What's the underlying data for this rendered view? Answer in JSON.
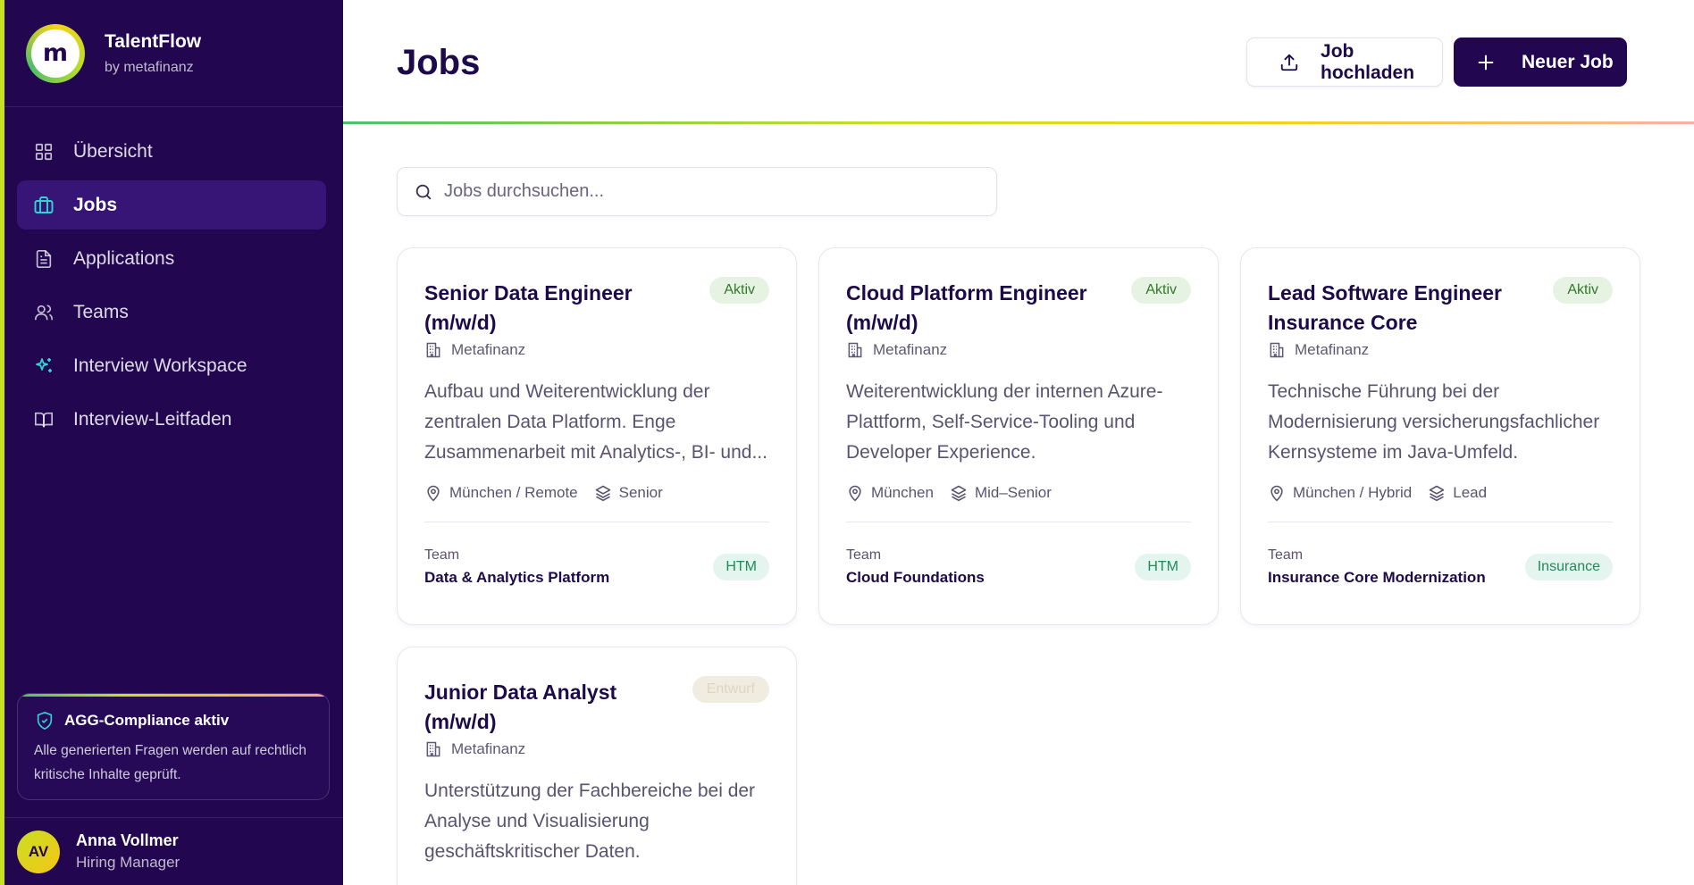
{
  "brand": {
    "name": "TalentFlow",
    "sub": "by metafinanz",
    "logo_letter": "m"
  },
  "nav": [
    {
      "label": "Übersicht",
      "icon": "grid-icon",
      "active": false
    },
    {
      "label": "Jobs",
      "icon": "briefcase-icon",
      "active": true
    },
    {
      "label": "Applications",
      "icon": "document-icon",
      "active": false
    },
    {
      "label": "Teams",
      "icon": "users-icon",
      "active": false
    },
    {
      "label": "Interview Workspace",
      "icon": "sparkles-icon",
      "active": false
    },
    {
      "label": "Interview-Leitfaden",
      "icon": "book-icon",
      "active": false
    }
  ],
  "compliance": {
    "title": "AGG-Compliance aktiv",
    "text": "Alle generierten Fragen werden auf rechtlich kritische Inhalte geprüft."
  },
  "user": {
    "initials": "AV",
    "name": "Anna Vollmer",
    "role": "Hiring Manager"
  },
  "header": {
    "title": "Jobs",
    "upload_label": "Job hochladen",
    "new_label": "Neuer Job"
  },
  "search": {
    "placeholder": "Jobs durchsuchen..."
  },
  "jobs": [
    {
      "title": "Senior Data Engineer (m/w/d)",
      "status": "Aktiv",
      "company": "Metafinanz",
      "description": "Aufbau und Weiterentwicklung der zentralen Data Platform. Enge Zusammenarbeit mit Analytics-, BI- und...",
      "location": "München / Remote",
      "level": "Senior",
      "team_label": "Team",
      "team": "Data & Analytics Platform",
      "team_tag": "HTM"
    },
    {
      "title": "Cloud Platform Engineer (m/w/d)",
      "status": "Aktiv",
      "company": "Metafinanz",
      "description": "Weiterentwicklung der internen Azure-Plattform, Self-Service-Tooling und Developer Experience.",
      "location": "München",
      "level": "Mid–Senior",
      "team_label": "Team",
      "team": "Cloud Foundations",
      "team_tag": "HTM"
    },
    {
      "title": "Lead Software Engineer Insurance Core",
      "status": "Aktiv",
      "company": "Metafinanz",
      "description": "Technische Führung bei der Modernisierung versicherungsfachlicher Kernsysteme im Java-Umfeld.",
      "location": "München / Hybrid",
      "level": "Lead",
      "team_label": "Team",
      "team": "Insurance Core Modernization",
      "team_tag": "Insurance"
    },
    {
      "title": "Junior Data Analyst (m/w/d)",
      "status": "Entwurf",
      "company": "Metafinanz",
      "description": "Unterstützung der Fachbereiche bei der Analyse und Visualisierung geschäftskritischer Daten."
    }
  ],
  "colors": {
    "sidebar": "#22064f",
    "sidebar_active": "#371577",
    "primary": "#22064f",
    "accent_lime": "#c7e020",
    "active_badge": "#2f7a2a",
    "team_badge": "#1f8a5b"
  }
}
